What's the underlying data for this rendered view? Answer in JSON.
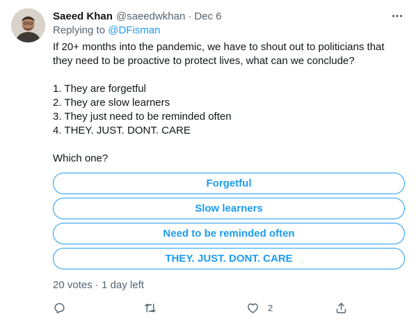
{
  "tweet": {
    "author_name": "Saeed Khan",
    "handle": "@saeedwkhan",
    "separator": "·",
    "date": "Dec 6",
    "replying_prefix": "Replying to",
    "replying_to": "@DFisman",
    "lines": [
      "If 20+ months into the pandemic, we have to shout out to politicians that",
      "they need to be proactive to protect lives, what can we conclude?",
      "1. They are forgetful",
      "2. They are slow learners",
      "3. They just need to be reminded often",
      "4. THEY. JUST. DONT. CARE",
      "Which one?"
    ]
  },
  "poll": {
    "choices": [
      "Forgetful",
      "Slow learners",
      "Need to be reminded often",
      "THEY. JUST. DONT. CARE"
    ],
    "meta": "20 votes · 1 day left"
  },
  "actions": {
    "like_count": "2"
  },
  "icons": {
    "more": "more-icon",
    "reply": "reply-icon",
    "retweet": "retweet-icon",
    "like": "like-icon",
    "share": "share-icon"
  },
  "colors": {
    "accent": "#1d9bf0",
    "secondary_text": "#536471",
    "primary_text": "#0f1419"
  }
}
